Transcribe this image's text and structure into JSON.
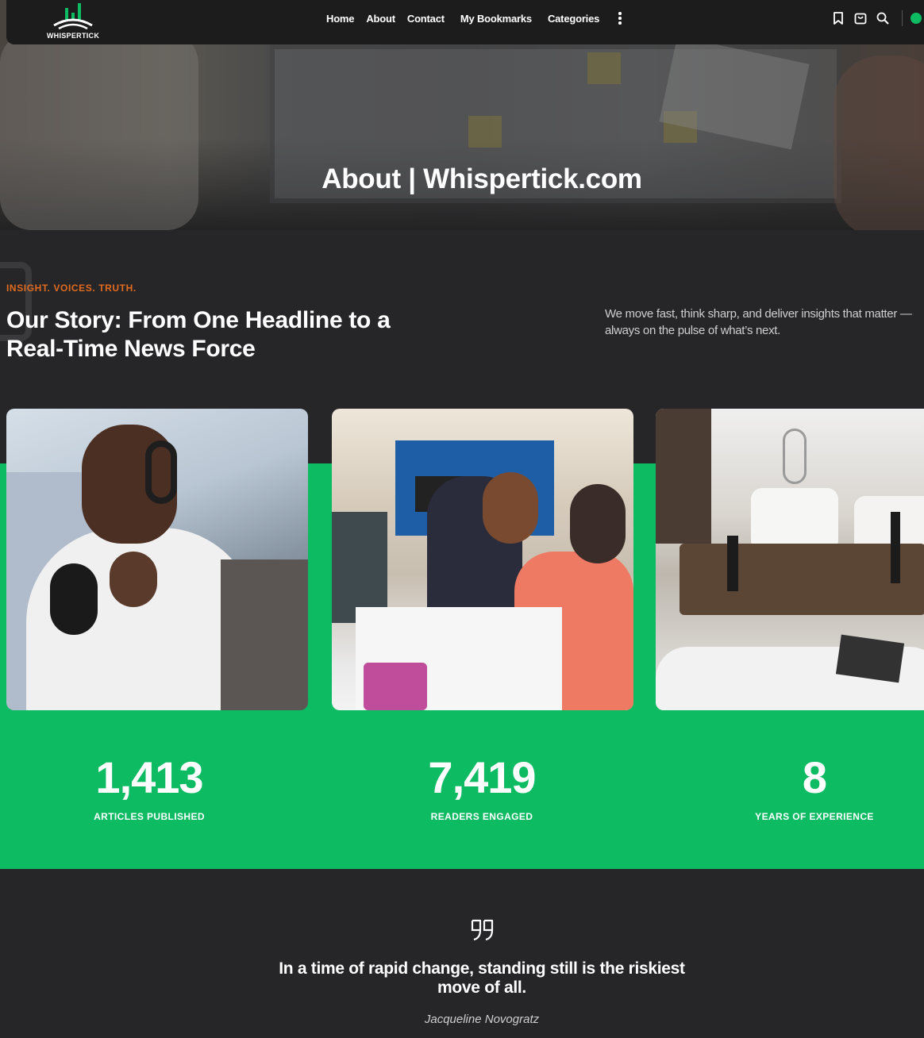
{
  "header": {
    "logo_text": "WHISPERTICK",
    "nav": [
      "Home",
      "About",
      "Contact",
      "My Bookmarks",
      "Categories"
    ],
    "icons": [
      "bookmark-icon",
      "cart-icon",
      "search-icon",
      "account-icon"
    ],
    "accent_color": "#0dbb63"
  },
  "hero": {
    "title": "About | Whispertick.com"
  },
  "story": {
    "eyebrow": "INSIGHT. VOICES. TRUTH.",
    "title": "Our Story: From One Headline to a Real-Time News Force",
    "description": "We move fast, think sharp, and deliver insights that matter — always on the pulse of what’s next."
  },
  "stats": [
    {
      "value": "1,413",
      "label": "ARTICLES PUBLISHED"
    },
    {
      "value": "7,419",
      "label": "READERS ENGAGED"
    },
    {
      "value": "8",
      "label": "YEARS OF EXPERIENCE"
    }
  ],
  "quote": {
    "text": "In a time of rapid change, standing still is the riskiest move of all.",
    "author": "Jacqueline Novogratz"
  },
  "colors": {
    "background": "#262628",
    "eyebrow": "#e06a1e",
    "band": "#0dbb63"
  }
}
